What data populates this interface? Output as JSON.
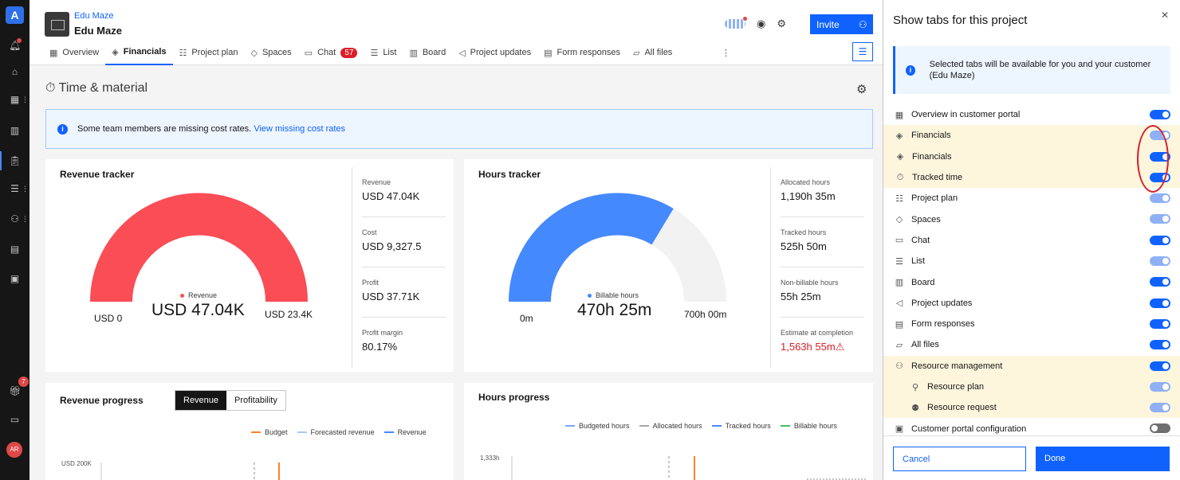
{
  "rail": {
    "logo": "A",
    "notification_badge": "7",
    "avatar": "AR"
  },
  "header": {
    "subtitle": "Edu Maze",
    "title": "Edu Maze",
    "invite_label": "Invite",
    "tabs": [
      {
        "label": "Overview",
        "icon": "grid-icon"
      },
      {
        "label": "Financials",
        "icon": "financials-icon",
        "active": true
      },
      {
        "label": "Project plan",
        "icon": "plan-icon"
      },
      {
        "label": "Spaces",
        "icon": "spaces-icon"
      },
      {
        "label": "Chat",
        "icon": "chat-icon",
        "badge": "57"
      },
      {
        "label": "List",
        "icon": "list-icon"
      },
      {
        "label": "Board",
        "icon": "board-icon"
      },
      {
        "label": "Project updates",
        "icon": "megaphone-icon"
      },
      {
        "label": "Form responses",
        "icon": "form-icon"
      },
      {
        "label": "All files",
        "icon": "folder-icon"
      }
    ]
  },
  "section": {
    "title": "Time & material"
  },
  "notice": {
    "text": "Some team members are missing cost rates.",
    "link": "View missing cost rates"
  },
  "revenue_tracker": {
    "title": "Revenue tracker",
    "gauge": {
      "label": "Revenue",
      "value": "USD 47.04K",
      "min": "USD 0",
      "max": "USD 23.4K",
      "fill_fraction": 1.0,
      "color": "#fa4d56"
    },
    "stats": [
      {
        "label": "Revenue",
        "value": "USD 47.04K"
      },
      {
        "label": "Cost",
        "value": "USD 9,327.5"
      },
      {
        "label": "Profit",
        "value": "USD 37.71K"
      },
      {
        "label": "Profit margin",
        "value": "80.17%"
      }
    ]
  },
  "hours_tracker": {
    "title": "Hours tracker",
    "gauge": {
      "label": "Billable hours",
      "value": "470h 25m",
      "min": "0m",
      "max": "700h 00m",
      "fill_fraction": 0.672,
      "color": "#4589ff"
    },
    "stats": [
      {
        "label": "Allocated hours",
        "value": "1,190h 35m"
      },
      {
        "label": "Tracked hours",
        "value": "525h 50m"
      },
      {
        "label": "Non-billable hours",
        "value": "55h 25m"
      },
      {
        "label": "Estimate at completion",
        "value": "1,563h 55m",
        "warning": true
      }
    ]
  },
  "revenue_progress": {
    "title": "Revenue progress",
    "toggle": [
      "Revenue",
      "Profitability"
    ],
    "legend": [
      "Budget",
      "Forecasted revenue",
      "Revenue"
    ],
    "y_label": "USD 200K"
  },
  "hours_progress": {
    "title": "Hours progress",
    "legend": [
      "Budgeted hours",
      "Allocated hours",
      "Tracked hours",
      "Billable hours"
    ],
    "y_label": "1,333h"
  },
  "panel": {
    "title": "Show tabs for this project",
    "info": "Selected tabs will be available for you and your customer (Edu Maze)",
    "items": [
      {
        "label": "Overview in customer portal",
        "icon": "grid-icon",
        "level": 0,
        "state": "on",
        "highlight": false
      },
      {
        "label": "Financials",
        "icon": "financials-icon",
        "level": 0,
        "state": "lite",
        "highlight": true
      },
      {
        "label": "Financials",
        "icon": "financials-icon",
        "level": 1,
        "state": "on",
        "highlight": true
      },
      {
        "label": "Tracked time",
        "icon": "timer-icon",
        "level": 1,
        "state": "on",
        "highlight": true
      },
      {
        "label": "Project plan",
        "icon": "plan-icon",
        "level": 0,
        "state": "lite",
        "highlight": false
      },
      {
        "label": "Spaces",
        "icon": "spaces-icon",
        "level": 0,
        "state": "lite",
        "highlight": false
      },
      {
        "label": "Chat",
        "icon": "chat-icon",
        "level": 0,
        "state": "on",
        "highlight": false
      },
      {
        "label": "List",
        "icon": "list-icon",
        "level": 0,
        "state": "lite",
        "highlight": false
      },
      {
        "label": "Board",
        "icon": "board-icon",
        "level": 0,
        "state": "on",
        "highlight": false
      },
      {
        "label": "Project updates",
        "icon": "megaphone-icon",
        "level": 0,
        "state": "on",
        "highlight": false
      },
      {
        "label": "Form responses",
        "icon": "form-icon",
        "level": 0,
        "state": "on",
        "highlight": false
      },
      {
        "label": "All files",
        "icon": "folder-icon",
        "level": 0,
        "state": "on",
        "highlight": false
      },
      {
        "label": "Resource management",
        "icon": "people-icon",
        "level": 0,
        "state": "on",
        "highlight": true
      },
      {
        "label": "Resource plan",
        "icon": "person-icon",
        "level": 2,
        "state": "lite",
        "highlight": true
      },
      {
        "label": "Resource request",
        "icon": "person-request-icon",
        "level": 2,
        "state": "lite",
        "highlight": true
      },
      {
        "label": "Customer portal configuration",
        "icon": "portal-icon",
        "level": 0,
        "state": "off",
        "highlight": false
      }
    ],
    "cancel_label": "Cancel",
    "done_label": "Done"
  },
  "colors": {
    "accent": "#0f62fe",
    "revenue": "#fa4d56",
    "hours": "#4589ff",
    "budget": "#ff832b",
    "billable": "#42be65"
  }
}
